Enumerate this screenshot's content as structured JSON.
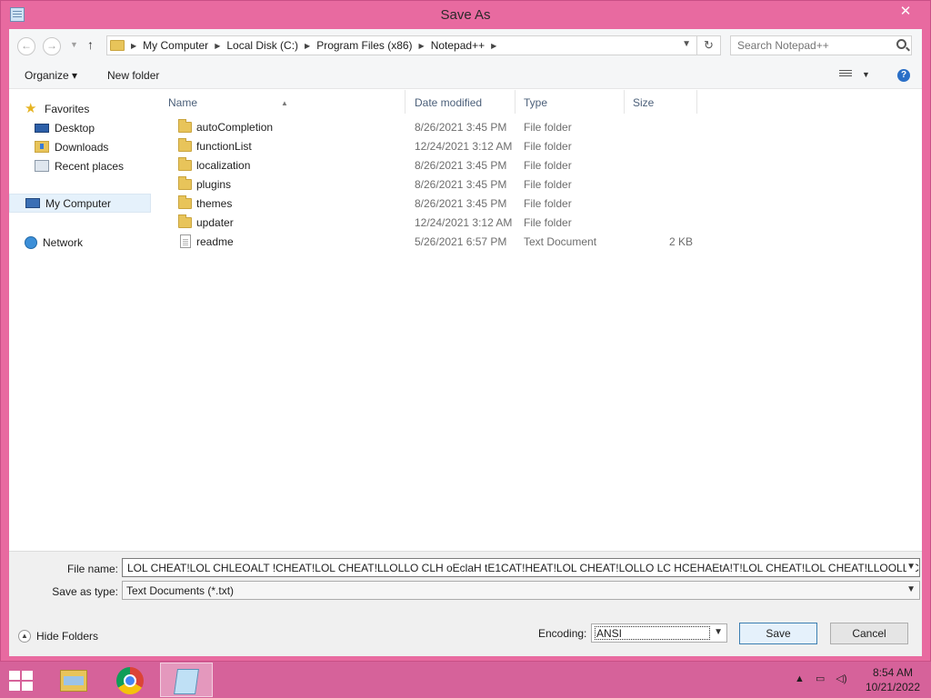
{
  "window": {
    "title": "Save As",
    "close_glyph": "✕"
  },
  "nav": {
    "back_glyph": "←",
    "forward_glyph": "→",
    "up_glyph": "↑",
    "refresh_glyph": "↻",
    "breadcrumbs": [
      "My Computer",
      "Local Disk (C:)",
      "Program Files (x86)",
      "Notepad++"
    ],
    "search_placeholder": "Search Notepad++"
  },
  "toolbar": {
    "organize_label": "Organize ▾",
    "new_folder_label": "New folder",
    "help_glyph": "?"
  },
  "sidebar": {
    "items": [
      {
        "label": "Favorites",
        "icon": "star-icon"
      },
      {
        "label": "Desktop",
        "icon": "desktop-icon"
      },
      {
        "label": "Downloads",
        "icon": "downloads-icon"
      },
      {
        "label": "Recent places",
        "icon": "recent-places-icon"
      },
      {
        "label": "My Computer",
        "icon": "computer-icon"
      },
      {
        "label": "Network",
        "icon": "network-icon"
      }
    ]
  },
  "filelist": {
    "columns": [
      "Name",
      "Date modified",
      "Type",
      "Size"
    ],
    "rows": [
      {
        "name": "autoCompletion",
        "date": "8/26/2021 3:45 PM",
        "type": "File folder",
        "size": "",
        "icon": "folder-icon"
      },
      {
        "name": "functionList",
        "date": "12/24/2021 3:12 AM",
        "type": "File folder",
        "size": "",
        "icon": "folder-icon"
      },
      {
        "name": "localization",
        "date": "8/26/2021 3:45 PM",
        "type": "File folder",
        "size": "",
        "icon": "folder-icon"
      },
      {
        "name": "plugins",
        "date": "8/26/2021 3:45 PM",
        "type": "File folder",
        "size": "",
        "icon": "folder-icon"
      },
      {
        "name": "themes",
        "date": "8/26/2021 3:45 PM",
        "type": "File folder",
        "size": "",
        "icon": "folder-icon"
      },
      {
        "name": "updater",
        "date": "12/24/2021 3:12 AM",
        "type": "File folder",
        "size": "",
        "icon": "folder-icon"
      },
      {
        "name": "readme",
        "date": "5/26/2021 6:57 PM",
        "type": "Text Document",
        "size": "2 KB",
        "icon": "text-document-icon"
      }
    ]
  },
  "save": {
    "file_name_label": "File name:",
    "file_name_value": "LOL CHEAT!LOL CHLEOALT !CHEAT!LOL CHEAT!LLOLLO CLH oEclaH tE1CAT!HEAT!LOL CHEAT!LOLLO LC HCEHAEtA!T!LOL CHEAT!LOL CHEAT!LLOOLL  CCHHI",
    "save_as_type_label": "Save as type:",
    "save_as_type_value": "Text Documents (*.txt)",
    "hide_folders_label": "Hide Folders",
    "encoding_label": "Encoding:",
    "encoding_value": "ANSI",
    "save_button": "Save",
    "cancel_button": "Cancel"
  },
  "taskbar": {
    "time": "8:54 AM",
    "date": "10/21/2022"
  },
  "colors": {
    "frame": "#e86aa0",
    "taskbar": "#d6629a",
    "selection": "#e5f1fb"
  }
}
